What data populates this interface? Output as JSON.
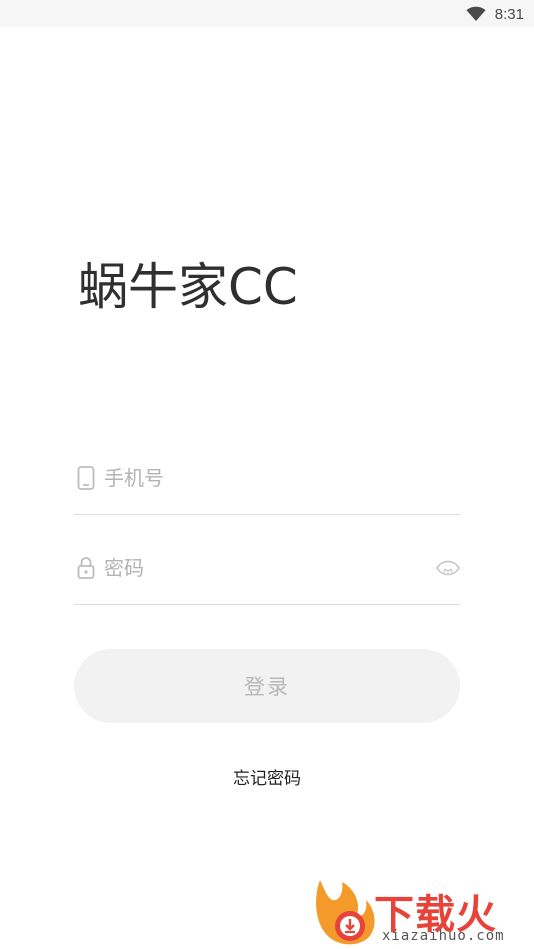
{
  "status_bar": {
    "time": "8:31",
    "wifi_icon": "wifi-icon"
  },
  "app": {
    "title": "蜗牛家CC"
  },
  "form": {
    "phone": {
      "icon": "phone-icon",
      "placeholder": "手机号",
      "value": ""
    },
    "password": {
      "icon": "lock-icon",
      "placeholder": "密码",
      "value": "",
      "toggle_icon": "eye-icon"
    },
    "login_label": "登录",
    "forgot_label": "忘记密码"
  },
  "watermark": {
    "text": "下载火",
    "url": "xiazaihuo.com",
    "colors": {
      "brand": "#e8433a",
      "flame": "#f39a2b"
    }
  },
  "colors": {
    "background": "#ffffff",
    "status_bar": "#f6f6f6",
    "button_bg": "#f2f2f2",
    "button_text": "#b8b8b8",
    "placeholder": "#b3b3b3",
    "divider": "#dcdcdc"
  }
}
